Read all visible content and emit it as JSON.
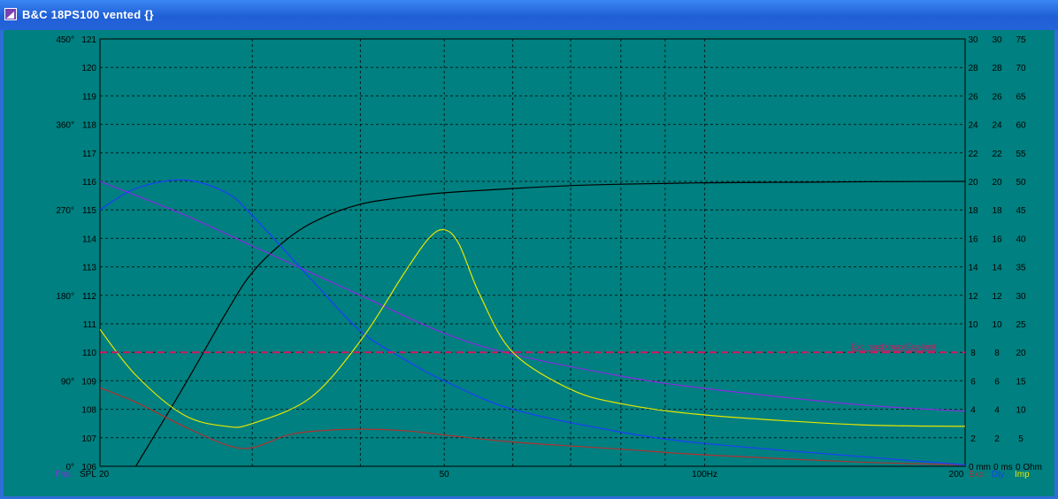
{
  "window": {
    "title": "B&C 18PS100 vented {}"
  },
  "plot": {
    "background": "#008080",
    "phase_axis_labels": [
      "450°",
      "360°",
      "270°",
      "180°",
      "90°",
      "0°"
    ],
    "spl_axis_labels": [
      "121",
      "120",
      "119",
      "118",
      "117",
      "116",
      "115",
      "114",
      "113",
      "112",
      "111",
      "110",
      "109",
      "108",
      "107",
      "106"
    ],
    "excursion_axis_labels": [
      "30",
      "28",
      "26",
      "24",
      "22",
      "20",
      "18",
      "16",
      "14",
      "12",
      "10",
      "8",
      "6",
      "4",
      "2",
      "0 mm"
    ],
    "delay_axis_labels": [
      "30",
      "28",
      "26",
      "24",
      "22",
      "20",
      "18",
      "16",
      "14",
      "12",
      "10",
      "8",
      "6",
      "4",
      "2",
      "0 ms"
    ],
    "impedance_axis_labels": [
      "75",
      "70",
      "65",
      "60",
      "55",
      "50",
      "45",
      "40",
      "35",
      "30",
      "25",
      "20",
      "15",
      "10",
      "5",
      "0 Ohm"
    ],
    "x_axis_labels": [
      "20",
      "50",
      "100Hz",
      "200"
    ],
    "bottom_legend": {
      "phase": "Pha",
      "spl": "SPL",
      "excursion": "Exc",
      "delay": "Dly",
      "impedance": "Imp"
    },
    "limit_label": "Exc max|Xmax|Exc-limit",
    "colors": {
      "spl": "#000000",
      "phase": "#8a2be2",
      "excursion": "#b03030",
      "delay": "#1e3cff",
      "impedance": "#e6e600",
      "limit": "#d01860",
      "grid": "#000000"
    }
  },
  "chart_data": {
    "type": "line",
    "title": "",
    "xlabel": "",
    "ylabel": "",
    "x_scale": "log",
    "xlim": [
      20,
      200
    ],
    "ylim_spl": [
      106,
      121
    ],
    "ylim_phase_deg": [
      0,
      450
    ],
    "ylim_excursion_mm": [
      0,
      30
    ],
    "ylim_delay_ms": [
      0,
      30
    ],
    "ylim_impedance_ohm": [
      0,
      75
    ],
    "grid": true,
    "series": [
      {
        "name": "SPL",
        "axis": "spl",
        "x": [
          22,
          25,
          28,
          30,
          33,
          36,
          40,
          45,
          50,
          60,
          70,
          80,
          100,
          130,
          160,
          200
        ],
        "y": [
          106,
          108.8,
          111.4,
          112.8,
          114,
          114.7,
          115.2,
          115.45,
          115.6,
          115.75,
          115.85,
          115.9,
          115.95,
          115.97,
          115.99,
          116
        ]
      },
      {
        "name": "Pha",
        "axis": "phase",
        "x": [
          20,
          25,
          30,
          40,
          50,
          60,
          80,
          100,
          150,
          200
        ],
        "y": [
          300,
          265,
          232,
          180,
          140,
          118,
          95,
          82,
          65,
          58
        ]
      },
      {
        "name": "Exc",
        "axis": "excursion",
        "x": [
          20,
          22,
          25,
          28,
          30,
          33,
          36,
          40,
          45,
          50,
          60,
          80,
          100,
          150,
          200
        ],
        "y": [
          5.5,
          4.5,
          2.8,
          1.5,
          1.3,
          2.2,
          2.5,
          2.6,
          2.5,
          2.2,
          1.7,
          1.2,
          0.8,
          0.3,
          0.1
        ]
      },
      {
        "name": "Dly",
        "axis": "delay",
        "x": [
          20,
          22,
          25,
          28,
          30,
          35,
          40,
          45,
          50,
          60,
          80,
          100,
          150,
          200
        ],
        "y": [
          18,
          19.5,
          20.1,
          19.2,
          17.6,
          13.2,
          9.5,
          7.5,
          6,
          4,
          2.4,
          1.6,
          0.7,
          0.1
        ]
      },
      {
        "name": "Imp",
        "axis": "impedance",
        "x": [
          20,
          22,
          25,
          28,
          30,
          35,
          40,
          45,
          48,
          50,
          52,
          55,
          60,
          70,
          80,
          100,
          150,
          200
        ],
        "y": [
          24,
          16,
          9,
          7,
          7.5,
          12,
          22,
          34,
          40,
          41.5,
          39,
          30,
          20,
          13.5,
          11,
          9,
          7.3,
          7
        ]
      },
      {
        "name": "Exc max|Xmax|Exc-limit",
        "axis": "excursion",
        "x": [
          20,
          200
        ],
        "y": [
          8,
          8
        ]
      }
    ]
  }
}
